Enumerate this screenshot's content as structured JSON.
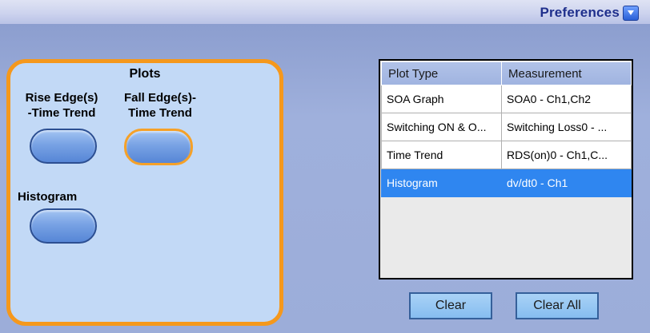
{
  "header": {
    "preferences_label": "Preferences",
    "preferences_icon": "chevron-down-icon"
  },
  "plots_panel": {
    "title": "Plots",
    "items": [
      {
        "label": "Rise Edge(s)\n-Time Trend",
        "selected": false
      },
      {
        "label": "Fall Edge(s)-\nTime Trend",
        "selected": true
      },
      {
        "label": "Histogram",
        "selected": false
      }
    ]
  },
  "table": {
    "columns": [
      "Plot Type",
      "Measurement"
    ],
    "rows": [
      {
        "plot_type": "SOA Graph",
        "measurement": "SOA0 - Ch1,Ch2",
        "selected": false
      },
      {
        "plot_type": "Switching ON & O...",
        "measurement": "Switching Loss0 - ...",
        "selected": false
      },
      {
        "plot_type": "Time Trend",
        "measurement": "RDS(on)0 - Ch1,C...",
        "selected": false
      },
      {
        "plot_type": "Histogram",
        "measurement": "dv/dt0 - Ch1",
        "selected": true
      }
    ]
  },
  "actions": {
    "clear_label": "Clear",
    "clear_all_label": "Clear All"
  },
  "colors": {
    "accent_orange": "#f5981c",
    "selection_blue": "#2f86f0",
    "panel_bg": "#c2d9f6"
  }
}
